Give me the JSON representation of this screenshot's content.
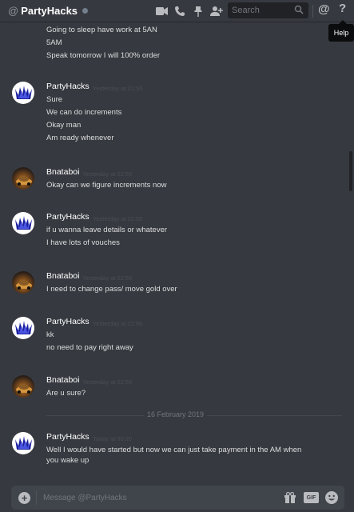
{
  "header": {
    "at_symbol": "@",
    "title": "PartyHacks",
    "search_placeholder": "Search",
    "mention_symbol": "@",
    "help_symbol": "?",
    "help_tooltip": "Help",
    "icons": [
      "video-call-icon",
      "voice-call-icon",
      "pin-icon",
      "add-friend-icon",
      "search-icon",
      "mention-icon",
      "help-icon"
    ]
  },
  "top_lines": [
    "Going to sleep have work at 5AN",
    "5AM",
    "Speak tomorrow I will 100% order"
  ],
  "messages": [
    {
      "author": "PartyHacks",
      "timestamp": "Yesterday at 22:55",
      "lines": [
        "Sure",
        "We can do increments",
        "Okay man",
        "Am ready whenever"
      ]
    },
    {
      "author": "Bnataboi",
      "timestamp": "Yesterday at 22:55",
      "lines": [
        "Okay can we figure increments now"
      ]
    },
    {
      "author": "PartyHacks",
      "timestamp": "Yesterday at 22:55",
      "lines": [
        "if u wanna leave details or whatever",
        "I have lots of vouches"
      ]
    },
    {
      "author": "Bnataboi",
      "timestamp": "Yesterday at 22:56",
      "lines": [
        "I need to change pass/ move gold over"
      ]
    },
    {
      "author": "PartyHacks",
      "timestamp": "Yesterday at 22:56",
      "lines": [
        "kk",
        "no need to pay right away"
      ]
    },
    {
      "author": "Bnataboi",
      "timestamp": "Yesterday at 22:56",
      "lines": [
        "Are u sure?"
      ]
    },
    {
      "author": "PartyHacks",
      "timestamp": "Today at 00:20",
      "lines": [
        "Well I would have started but now we can just take payment in the AM when",
        "you wake up"
      ]
    }
  ],
  "date_divider": "16 February 2019",
  "composer": {
    "placeholder": "Message @PartyHacks",
    "add_symbol": "+",
    "gif_label": "GIF"
  },
  "colors": {
    "background": "#36393f",
    "composer": "#40444b",
    "username": "#ffffff",
    "timestamp": "#4b4e54",
    "text": "#dcddde"
  }
}
